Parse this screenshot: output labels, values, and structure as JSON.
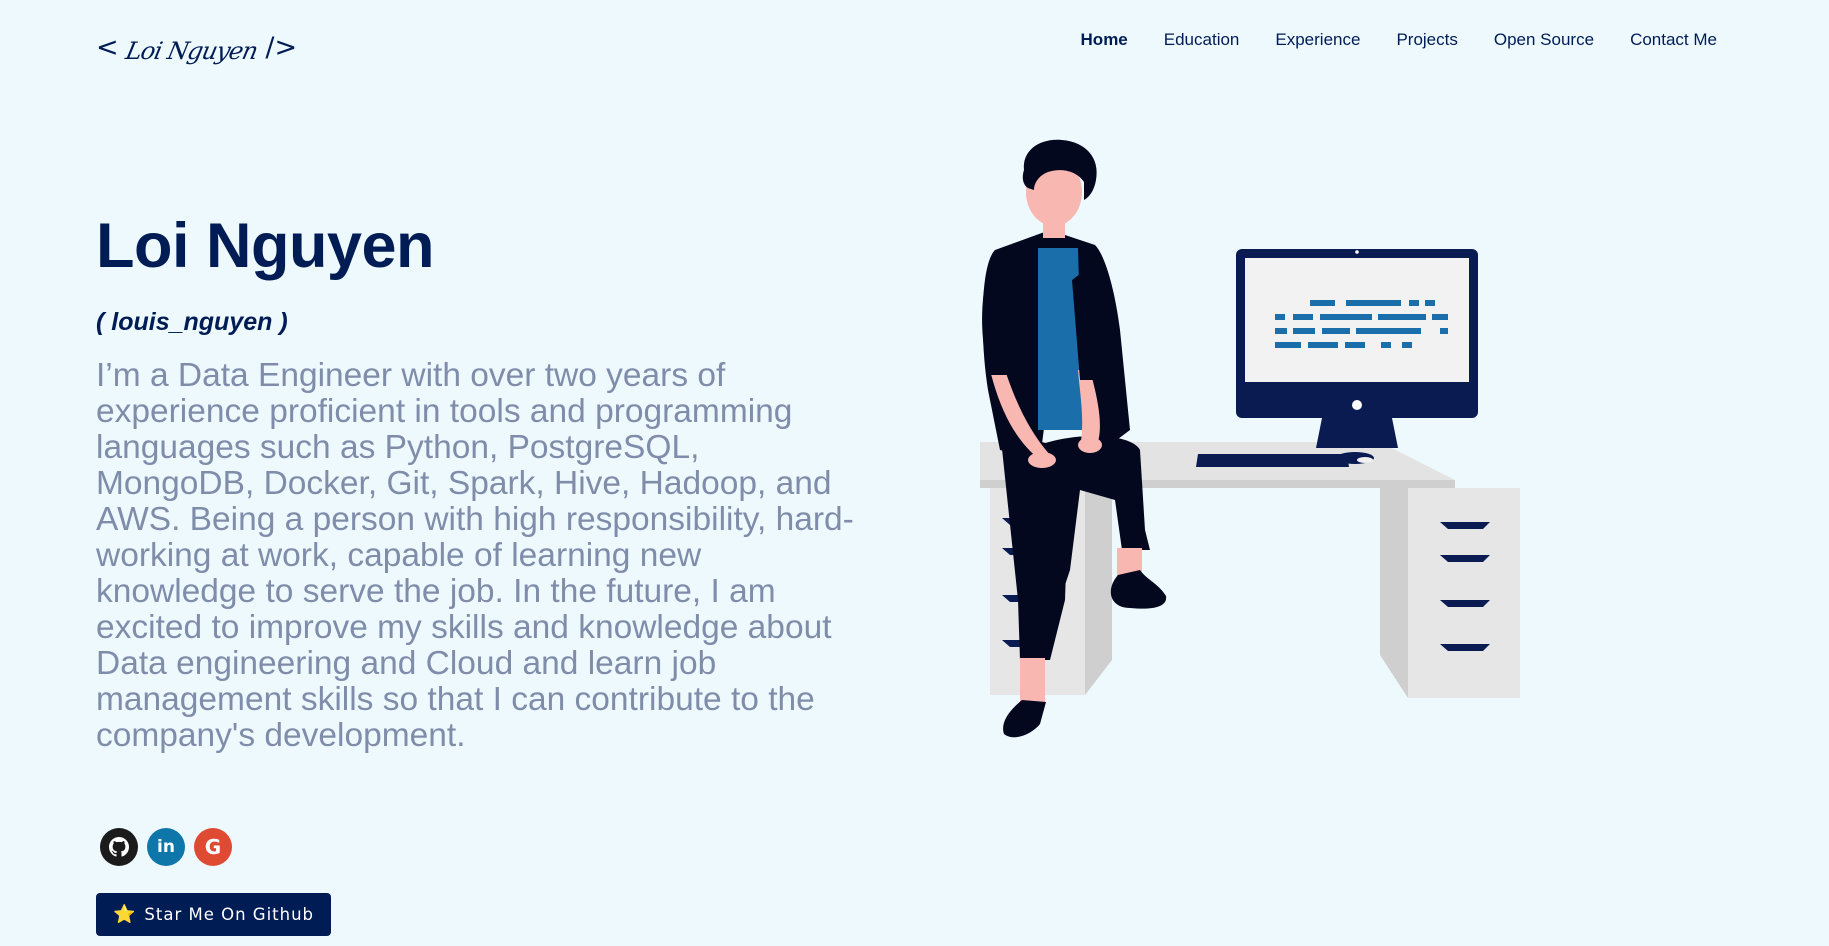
{
  "header": {
    "logo_left": "<",
    "logo_signature": "Loi Nguyen",
    "logo_right": "/>",
    "nav": [
      {
        "label": "Home",
        "active": true
      },
      {
        "label": "Education",
        "active": false
      },
      {
        "label": "Experience",
        "active": false
      },
      {
        "label": "Projects",
        "active": false
      },
      {
        "label": "Open Source",
        "active": false
      },
      {
        "label": "Contact Me",
        "active": false
      }
    ]
  },
  "hero": {
    "name": "Loi Nguyen",
    "nickname": "( louis_nguyen )",
    "bio": "I’m a Data Engineer with over two years of experience proficient in tools and programming languages such as Python, PostgreSQL, MongoDB, Docker, Git, Spark, Hive, Hadoop, and AWS. Being a person with high responsibility, hard-working at work, capable of learning new knowledge to serve the job. In the future, I am excited to improve my skills and knowledge about Data engineering and Cloud and learn job management skills so that I can contribute to the company's development.",
    "socials": [
      {
        "icon": "github-icon",
        "glyph": "",
        "color": "#1b1b1b"
      },
      {
        "icon": "linkedin-icon",
        "glyph": "in",
        "color": "#0e76a8"
      },
      {
        "icon": "google-icon",
        "glyph": "G",
        "color": "#df4a32"
      }
    ],
    "star_button": {
      "icon": "star-icon",
      "star_glyph": "⭐",
      "label": "Star Me On Github"
    }
  },
  "colors": {
    "background": "#eef9fe",
    "primary": "#001c55",
    "body_text": "#7f8daa",
    "accent_blue": "#1a6fab"
  }
}
